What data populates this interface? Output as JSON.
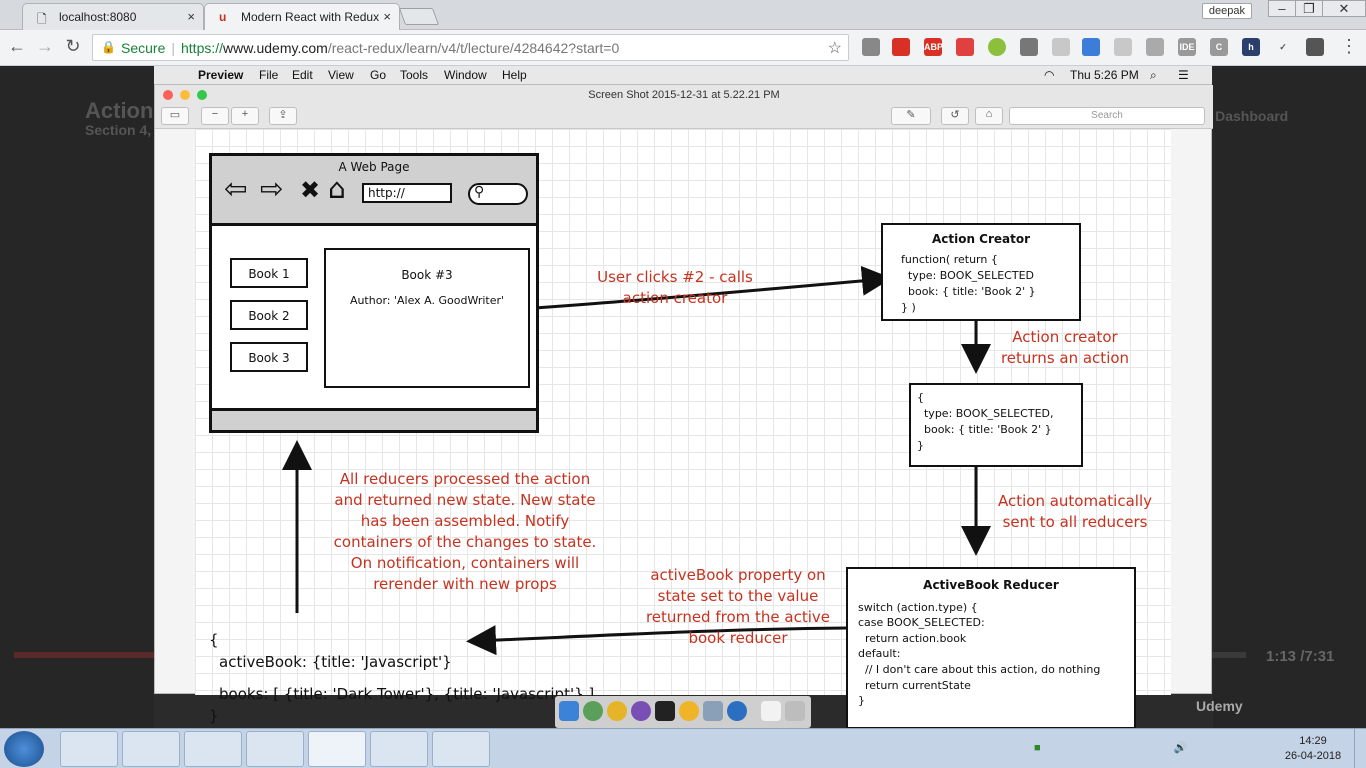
{
  "browser": {
    "tabs": [
      {
        "title": "localhost:8080",
        "close": "×"
      },
      {
        "title": "Modern React with Redux",
        "close": "×"
      }
    ],
    "user_badge": "deepak",
    "window_controls": [
      "–",
      "❐",
      "✕"
    ],
    "address": {
      "secure_label": "Secure",
      "url_scheme": "https://",
      "url_domain": "www.udemy.com",
      "url_path": "/react-redux/learn/v4/t/lecture/4284642?start=0"
    }
  },
  "course_page": {
    "title": "Action",
    "section": "Section 4,",
    "dashboard_link": "to Dashboard",
    "time": "1:13 /7:31",
    "progress": 0.158,
    "brand": "Udemy"
  },
  "mac": {
    "app": "Preview",
    "menus": [
      "File",
      "Edit",
      "View",
      "Go",
      "Tools",
      "Window",
      "Help"
    ],
    "clock": "Thu 5:26 PM",
    "window_title": "Screen Shot 2015-12-31 at 5.22.21 PM",
    "search_placeholder": "Search"
  },
  "diagram": {
    "webpage": {
      "title": "A Web Page",
      "url": "http://",
      "books": [
        "Book 1",
        "Book 2",
        "Book 3"
      ],
      "detail_title": "Book #3",
      "detail_author": "Author: 'Alex A. GoodWriter'"
    },
    "action_creator": {
      "title": "Action Creator",
      "lines": [
        "function( return {",
        "  type: BOOK_SELECTED",
        "  book: { title: 'Book 2' }",
        "} )"
      ]
    },
    "action": {
      "lines": [
        "{",
        "  type: BOOK_SELECTED,",
        "  book: { title: 'Book 2' }",
        "}"
      ]
    },
    "reducer": {
      "title": "ActiveBook Reducer",
      "lines": [
        "switch (action.type) {",
        "case BOOK_SELECTED:",
        "  return action.book",
        "default:",
        "  // I don't care about this action, do nothing",
        "  return currentState",
        "}"
      ]
    },
    "state": {
      "open": "{",
      "active": "activeBook: {title: 'Javascript'}",
      "books": "books: [ {title: 'Dark Tower'}, {title: 'Javascript'} ]",
      "close": "}"
    },
    "notes": {
      "user_clicks": [
        "User clicks #2 - calls",
        "action creator"
      ],
      "returns_action": [
        "Action creator",
        "returns an action"
      ],
      "auto_sent": [
        "Action automatically",
        "sent to all reducers"
      ],
      "property": [
        "activeBook property on",
        "state set to the value",
        "returned from the active",
        "book reducer"
      ],
      "processed": [
        "All reducers processed the action",
        "and returned new state.  New state",
        "has been assembled.  Notify",
        "containers of the changes to state.",
        "On notification, containers will",
        "rerender with new props"
      ]
    }
  },
  "taskbar": {
    "time": "14:29",
    "date": "26-04-2018"
  }
}
